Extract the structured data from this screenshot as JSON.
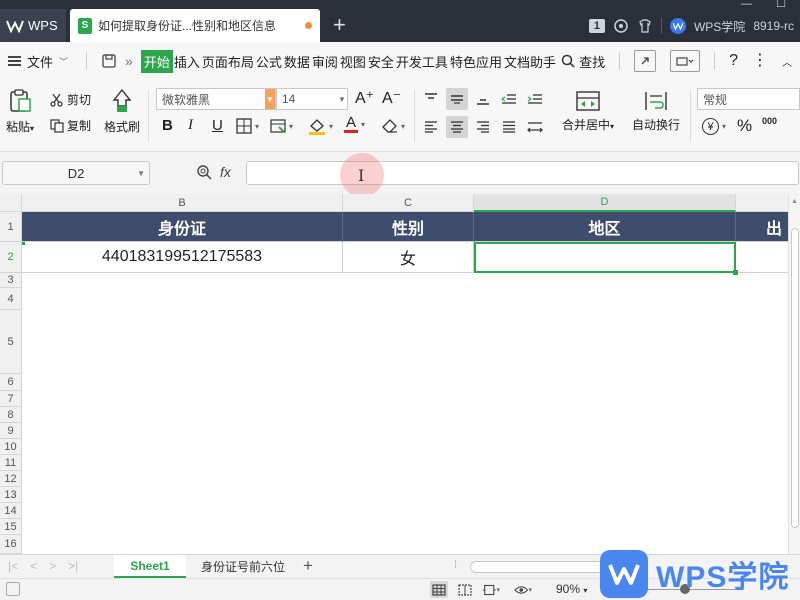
{
  "titlebar": {
    "app_tab": "WPS",
    "doc_tab_title": "如何提取身份证...性别和地区信息",
    "doc_icon_letter": "S",
    "new_tab": "+",
    "badge": "1",
    "right_label": "WPS学院",
    "user_id": "8919-rc",
    "minimize": "—",
    "maximize": "☐"
  },
  "menubar": {
    "file": "文件",
    "items": [
      "开始",
      "插入",
      "页面布局",
      "公式",
      "数据",
      "审阅",
      "视图",
      "安全",
      "开发工具",
      "特色应用",
      "文档助手"
    ],
    "active_index": 0,
    "search": "查找",
    "help": "?"
  },
  "ribbon": {
    "paste": "粘贴",
    "cut": "剪切",
    "copy": "复制",
    "format_painter": "格式刷",
    "font_name": "微软雅黑",
    "font_size": "14",
    "bold": "B",
    "italic": "I",
    "underline": "U",
    "font_color_glyph": "A",
    "increase_font": "A⁺",
    "decrease_font": "A⁻",
    "merge_center": "合并居中",
    "wrap_text": "自动换行",
    "number_format": "常规",
    "currency": "¥",
    "percent": "%",
    "decimal_glyph": "000"
  },
  "formula": {
    "cell_ref": "D2",
    "fx": "fx",
    "value": ""
  },
  "grid": {
    "columns": [
      {
        "label": "B",
        "selected": false
      },
      {
        "label": "C",
        "selected": false
      },
      {
        "label": "D",
        "selected": true
      }
    ],
    "rows": [
      "1",
      "2",
      "3",
      "4",
      "5",
      "6",
      "7",
      "8",
      "9",
      "10",
      "11",
      "12",
      "13",
      "14",
      "15",
      "16"
    ],
    "selected_row": "2",
    "header_row": [
      "身份证",
      "性别",
      "地区",
      "出"
    ],
    "data_row": [
      "440183199512175583",
      "女",
      ""
    ]
  },
  "sheets": {
    "tabs": [
      "Sheet1",
      "身份证号前六位"
    ],
    "active_index": 0,
    "add": "+"
  },
  "status": {
    "zoom": "90%",
    "zoom_minus": "—"
  },
  "watermark": {
    "text": "WPS学院"
  },
  "colors": {
    "accent_green": "#2ca64c",
    "header_fill": "#3d4d6b",
    "titlebar_bg": "#2b2f3a",
    "brand_blue": "#4a86f0"
  }
}
